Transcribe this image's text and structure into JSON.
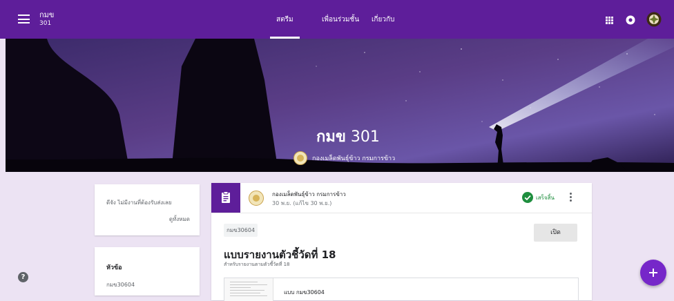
{
  "header": {
    "class_name": "กมข",
    "class_section": "301",
    "tabs": [
      {
        "label": "สตรีม",
        "active": true
      },
      {
        "label": "เพื่อนร่วมชั้น",
        "active": false
      },
      {
        "label": "เกี่ยวกับ",
        "active": false
      }
    ],
    "icons": [
      "menu-icon",
      "apps-grid-icon",
      "notifications-icon",
      "account-avatar"
    ]
  },
  "banner": {
    "title_bold": "กมข",
    "title_rest": " 301",
    "owner": "กองเมล็ดพันธุ์ข้าว กรมการข้าว"
  },
  "upcoming": {
    "message": "ดีจัง ไม่มีงานที่ต้องรับส่งเลย",
    "view_all": "ดูทั้งหมด"
  },
  "topics": {
    "heading": "หัวข้อ",
    "items": [
      "กมข30604"
    ]
  },
  "post": {
    "author": "กองเมล็ดพันธุ์ข้าว กรมการข้าว",
    "date": "30 พ.ย. (แก้ไข 30 พ.ย.)",
    "status": "เสร็จสิ้น",
    "topic": "กมข30604",
    "open_label": "เปิด",
    "title": "แบบรายงานตัวชี้วัดที่ 18",
    "subtitle": "สำหรับรายงานตามตัวชี้วัดที่ 18",
    "attachment": "แบบ กมข30604"
  },
  "colors": {
    "primary": "#5e1e9a",
    "fab": "#7627c9",
    "background": "#ece3f3",
    "done": "#1e8e3e"
  }
}
